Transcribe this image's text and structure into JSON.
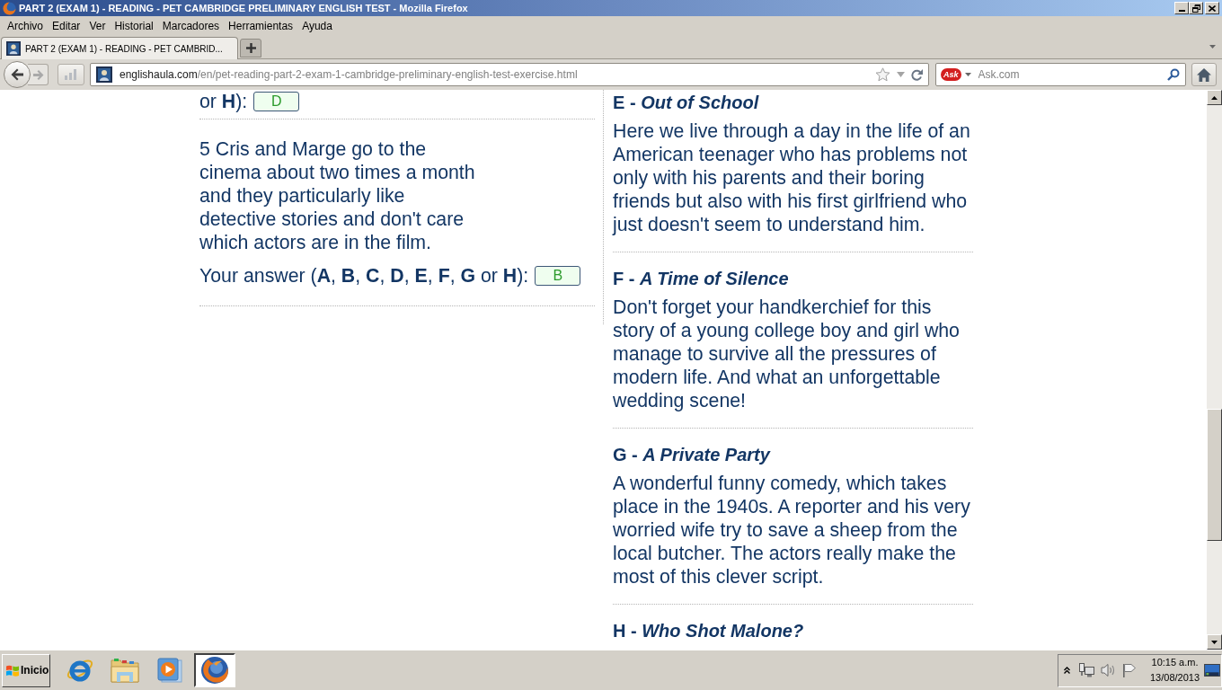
{
  "window": {
    "title": "PART 2 (EXAM 1) - READING - PET CAMBRIDGE PRELIMINARY ENGLISH TEST - Mozilla Firefox"
  },
  "menu_bar": [
    "Archivo",
    "Editar",
    "Ver",
    "Historial",
    "Marcadores",
    "Herramientas",
    "Ayuda"
  ],
  "tabs": [
    {
      "label": "PART 2 (EXAM 1) - READING - PET CAMBRID...",
      "selected": true
    }
  ],
  "navigation": {
    "url": {
      "host": "englishaula.com",
      "path": "/en/pet-reading-part-2-exam-1-cambridge-preliminary-english-test-exercise.html"
    },
    "search": {
      "engine_logo": "Ask",
      "placeholder": "Ask.com"
    }
  },
  "questions": [
    {
      "prompt": "or **H**):",
      "answer": "D"
    },
    {
      "text": "5 Cris and Marge go to the cinema about two times a month and they particularly like detective stories and don't care which actors are in the film.",
      "prompt": "Your answer (**A**, **B**, **C**, **D**, **E**, **F**, **G** or **H**):",
      "answer": "B"
    }
  ],
  "reviews": [
    {
      "heading": "E - *Out of School*",
      "text": "Here we live through a day in the life of an American teenager who has problems not only with his parents and their boring friends but also with his first girlfriend who just doesn't seem to understand him."
    },
    {
      "heading": "F - *A Time of Silence*",
      "text": "Don't forget your handkerchief for this story of a young college boy and girl who manage to survive all the pressures of modern life. And what an unforgettable wedding scene!"
    },
    {
      "heading": "G - *A Private Party*",
      "text": "A wonderful funny comedy, which takes place in the 1940s. A reporter and his very worried wife try to save a sheep from the local butcher. The actors really make the most of this clever script."
    },
    {
      "heading": "H - *Who Shot Malone?*"
    }
  ],
  "taskbar": {
    "start_button": "Inicio",
    "programs": [
      {
        "active": false
      },
      {
        "active": false
      },
      {
        "active": false
      },
      {
        "active": true
      }
    ],
    "clock": {
      "time": "10:15 a.m.",
      "date": "13/08/2013"
    }
  }
}
